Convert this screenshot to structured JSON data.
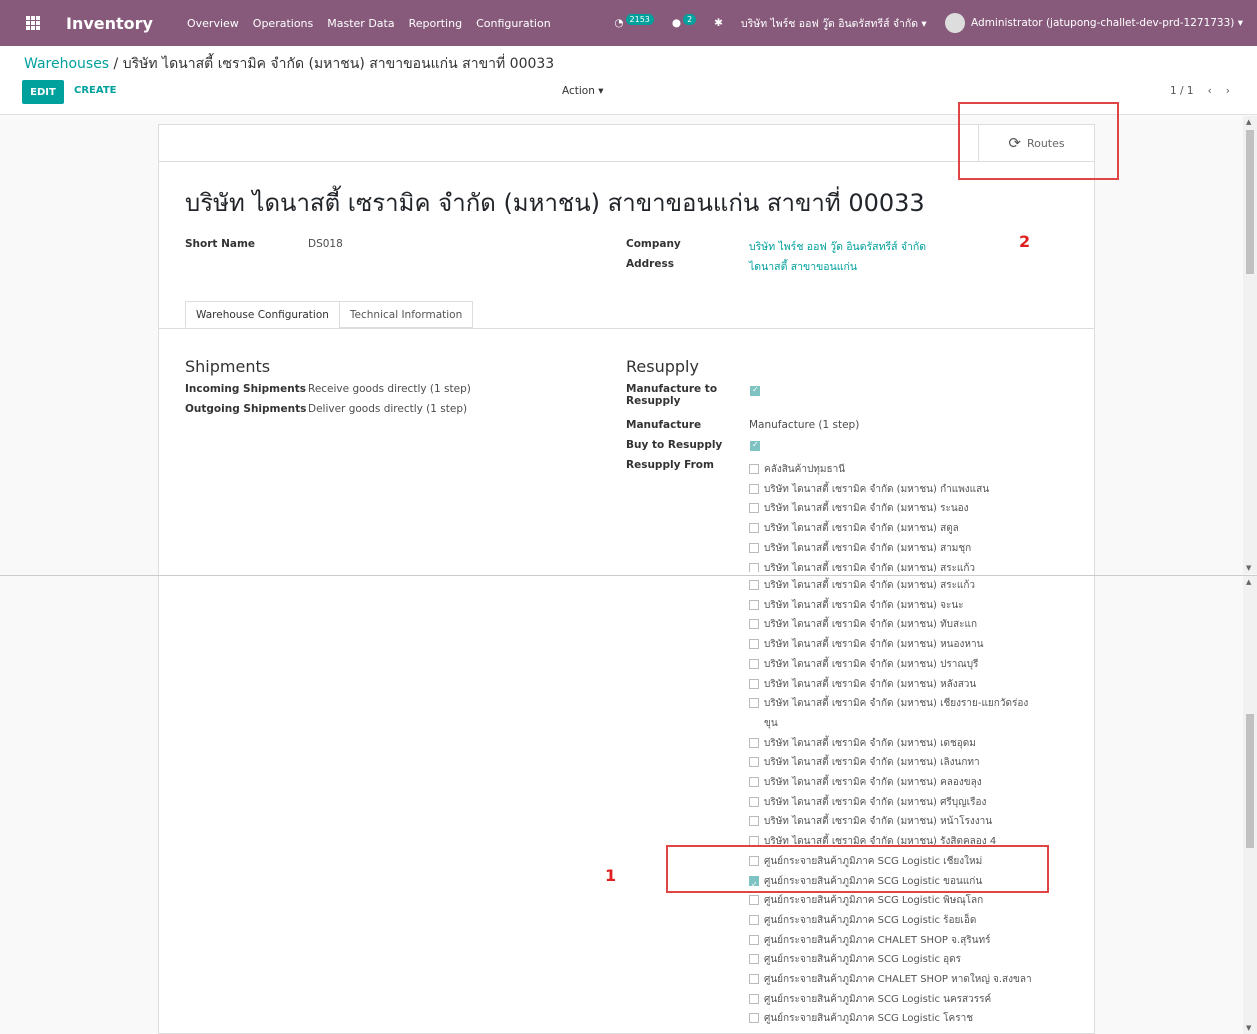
{
  "app": {
    "brand": "Inventory",
    "menu": [
      "Overview",
      "Operations",
      "Master Data",
      "Reporting",
      "Configuration"
    ],
    "activity_count": "2153",
    "message_count": "2",
    "company_switcher": "บริษัท ไพร์ช ออฟ วู๊ด อินดรัสทรีส์ จำกัด ▾",
    "user": "Administrator (jatupong-challet-dev-prd-1271733) ▾"
  },
  "breadcrumb": {
    "parent": "Warehouses",
    "separator": " / ",
    "current": "บริษัท ไดนาสตี้ เซรามิค จำกัด (มหาชน) สาขาขอนแก่น สาขาที่ 00033"
  },
  "control": {
    "edit": "EDIT",
    "create": "CREATE",
    "action": "Action ▾",
    "pager": "1 / 1"
  },
  "form": {
    "routes_button": "Routes",
    "title": "บริษัท ไดนาสตี้ เซรามิค จำกัด (มหาชน) สาขาขอนแก่น สาขาที่ 00033",
    "short_name_label": "Short Name",
    "short_name_value": "DS018",
    "company_label": "Company",
    "company_value": "บริษัท ไพร์ช ออฟ วู๊ด อินดรัสทรีส์ จำกัด",
    "address_label": "Address",
    "address_value": "ไดนาสตี้ สาขาขอนแก่น",
    "tabs": [
      "Warehouse Configuration",
      "Technical Information"
    ],
    "shipments_title": "Shipments",
    "incoming_label": "Incoming Shipments",
    "incoming_value": "Receive goods directly (1 step)",
    "outgoing_label": "Outgoing Shipments",
    "outgoing_value": "Deliver goods directly (1 step)",
    "resupply_title": "Resupply",
    "mto_label_1": "Manufacture to",
    "mto_label_2": "Resupply",
    "manufacture_label": "Manufacture",
    "manufacture_value": "Manufacture (1 step)",
    "buy_label": "Buy to Resupply",
    "resupply_from_label": "Resupply From"
  },
  "resupply_top": [
    {
      "label": "คลังสินค้าปทุมธานี",
      "checked": false
    },
    {
      "label": "บริษัท ไดนาสตี้ เซรามิค จำกัด (มหาชน) กำแพงแสน",
      "checked": false
    },
    {
      "label": "บริษัท ไดนาสตี้ เซรามิค จำกัด (มหาชน) ระนอง",
      "checked": false
    },
    {
      "label": "บริษัท ไดนาสตี้ เซรามิค จำกัด (มหาชน) สตูล",
      "checked": false
    },
    {
      "label": "บริษัท ไดนาสตี้ เซรามิค จำกัด (มหาชน) สามชุก",
      "checked": false
    },
    {
      "label": "บริษัท ไดนาสตี้ เซรามิค จำกัด (มหาชน) สระแก้ว",
      "checked": false
    }
  ],
  "resupply_bottom": [
    {
      "label": "บริษัท ไดนาสตี้ เซรามิค จำกัด (มหาชน) สระแก้ว",
      "checked": false
    },
    {
      "label": "บริษัท ไดนาสตี้ เซรามิค จำกัด (มหาชน) จะนะ",
      "checked": false
    },
    {
      "label": "บริษัท ไดนาสตี้ เซรามิค จำกัด (มหาชน) ทับสะแก",
      "checked": false
    },
    {
      "label": "บริษัท ไดนาสตี้ เซรามิค จำกัด (มหาชน) หนองหาน",
      "checked": false
    },
    {
      "label": "บริษัท ไดนาสตี้ เซรามิค จำกัด (มหาชน) ปราณบุรี",
      "checked": false
    },
    {
      "label": "บริษัท ไดนาสตี้ เซรามิค จำกัด (มหาชน) หลังสวน",
      "checked": false
    },
    {
      "label": "บริษัท ไดนาสตี้ เซรามิค จำกัด (มหาชน) เชียงราย-แยกวัดร่องขุน",
      "checked": false
    },
    {
      "label": "บริษัท ไดนาสตี้ เซรามิค จำกัด (มหาชน) เดชอุดม",
      "checked": false
    },
    {
      "label": "บริษัท ไดนาสตี้ เซรามิค จำกัด (มหาชน) เลิงนกทา",
      "checked": false
    },
    {
      "label": "บริษัท ไดนาสตี้ เซรามิค จำกัด (มหาชน) คลองขลุง",
      "checked": false
    },
    {
      "label": "บริษัท ไดนาสตี้ เซรามิค จำกัด (มหาชน) ศรีบุญเรือง",
      "checked": false
    },
    {
      "label": "บริษัท ไดนาสตี้ เซรามิค จำกัด (มหาชน) หน้าโรงงาน",
      "checked": false
    },
    {
      "label": "บริษัท ไดนาสตี้ เซรามิค จำกัด (มหาชน) รังสิตคลอง 4",
      "checked": false
    },
    {
      "label": "ศูนย์กระจายสินค้าภูมิภาค SCG Logistic เชียงใหม่",
      "checked": false
    },
    {
      "label": "ศูนย์กระจายสินค้าภูมิภาค SCG Logistic ขอนแก่น",
      "checked": true
    },
    {
      "label": "ศูนย์กระจายสินค้าภูมิภาค SCG Logistic พิษณุโลก",
      "checked": false
    },
    {
      "label": "ศูนย์กระจายสินค้าภูมิภาค SCG Logistic ร้อยเอ็ด",
      "checked": false
    },
    {
      "label": "ศูนย์กระจายสินค้าภูมิภาค CHALET SHOP จ.สุรินทร์",
      "checked": false
    },
    {
      "label": "ศูนย์กระจายสินค้าภูมิภาค SCG Logistic อุดร",
      "checked": false
    },
    {
      "label": "ศูนย์กระจายสินค้าภูมิภาค CHALET SHOP หาดใหญ่ จ.สงขลา",
      "checked": false
    },
    {
      "label": "ศูนย์กระจายสินค้าภูมิภาค SCG Logistic นครสวรรค์",
      "checked": false
    },
    {
      "label": "ศูนย์กระจายสินค้าภูมิภาค SCG Logistic โคราช",
      "checked": false
    }
  ],
  "annotations": {
    "one": "1",
    "two": "2"
  },
  "colors": {
    "navbar": "#875a7b",
    "accent": "#00a09d",
    "annotation": "#e04545"
  }
}
